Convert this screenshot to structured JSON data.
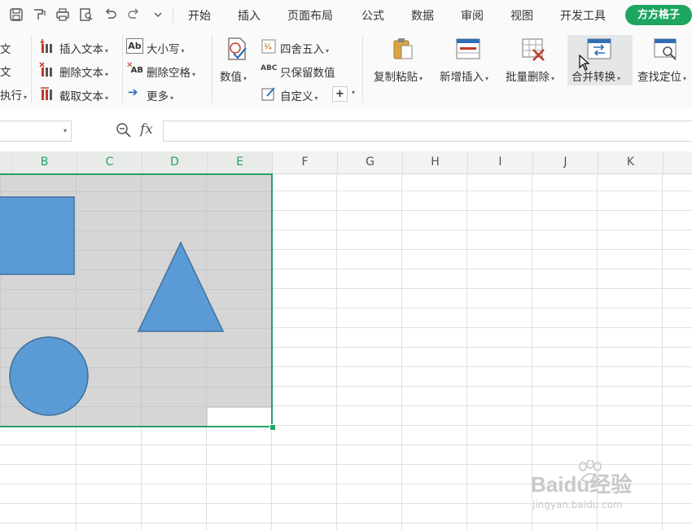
{
  "menu": {
    "tabs": [
      "开始",
      "插入",
      "页面布局",
      "公式",
      "数据",
      "审阅",
      "视图",
      "开发工具"
    ],
    "addon_label": "方方格子",
    "quick_icons": [
      "save-icon",
      "format-painter-icon",
      "print-icon",
      "print-preview-icon",
      "undo-icon",
      "redo-icon",
      "customize-dropdown-icon"
    ]
  },
  "ribbon": {
    "left_partial": [
      "文",
      "文",
      "执行"
    ],
    "text_group": {
      "insert_text": "插入文本",
      "delete_text": "删除文本",
      "extract_text": "截取文本",
      "case": "大小写",
      "delete_spaces": "删除空格",
      "more": "更多"
    },
    "number_group": {
      "value": "数值",
      "round": "四舍五入",
      "keep_value": "只保留数值",
      "custom": "自定义"
    },
    "edit_group": {
      "copy_paste": "复制粘贴",
      "add_insert": "新增插入",
      "batch_delete": "批量删除",
      "merge_convert": "合并转换",
      "find_locate": "查找定位"
    }
  },
  "formula_bar": {
    "name_box_value": "",
    "fx_label": "fx",
    "formula_value": ""
  },
  "sheet": {
    "columns": [
      "B",
      "C",
      "D",
      "E",
      "F",
      "G",
      "H",
      "I",
      "J",
      "K"
    ],
    "selected_columns": [
      "B",
      "C",
      "D",
      "E"
    ]
  },
  "shapes": {
    "fill": "#5b9bd5",
    "stroke": "#41719c",
    "items": [
      "rectangle",
      "triangle",
      "circle"
    ]
  },
  "colors": {
    "accent": "#1ea55f",
    "selection_border": "#21a366"
  },
  "watermark": {
    "brand": "Baidu经验",
    "url": "jingyan.baidu.com"
  }
}
